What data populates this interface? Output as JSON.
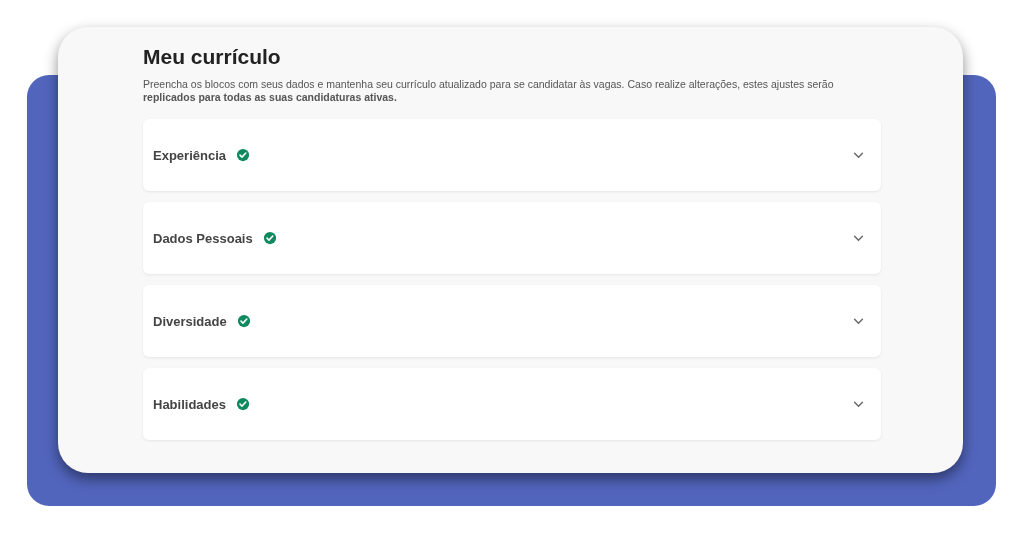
{
  "title": "Meu currículo",
  "description": "Preencha os blocos com seus dados e mantenha seu currículo atualizado para se candidatar às vagas. Caso realize alterações, estes ajustes serão **replicados para todas as suas candidaturas ativas.**",
  "sections": [
    {
      "label": "Experiência",
      "completed": true,
      "expanded": false
    },
    {
      "label": "Dados Pessoais",
      "completed": true,
      "expanded": false
    },
    {
      "label": "Diversidade",
      "completed": true,
      "expanded": false
    },
    {
      "label": "Habilidades",
      "completed": true,
      "expanded": false
    }
  ]
}
